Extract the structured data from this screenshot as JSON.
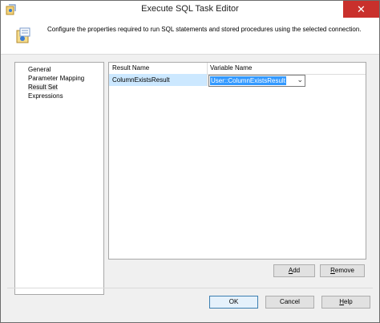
{
  "window": {
    "title": "Execute SQL Task Editor",
    "close_glyph": "✕"
  },
  "header": {
    "description": "Configure the properties required to run SQL statements and stored procedures using the selected connection."
  },
  "nav": {
    "items": [
      {
        "label": "General"
      },
      {
        "label": "Parameter Mapping"
      },
      {
        "label": "Result Set",
        "selected": true
      },
      {
        "label": "Expressions"
      }
    ]
  },
  "grid": {
    "columns": [
      "Result Name",
      "Variable Name"
    ],
    "rows": [
      {
        "result_name": "ColumnExistsResult",
        "variable_name": "User::ColumnExistsResult"
      }
    ]
  },
  "buttons": {
    "add": {
      "mnemonic": "A",
      "rest": "dd"
    },
    "remove": {
      "mnemonic": "R",
      "rest": "emove"
    },
    "ok": "OK",
    "cancel": "Cancel",
    "help": {
      "mnemonic": "H",
      "rest": "elp"
    }
  },
  "colors": {
    "selection": "#3399ff",
    "row_highlight": "#cce8ff",
    "close_button": "#c9302c"
  }
}
